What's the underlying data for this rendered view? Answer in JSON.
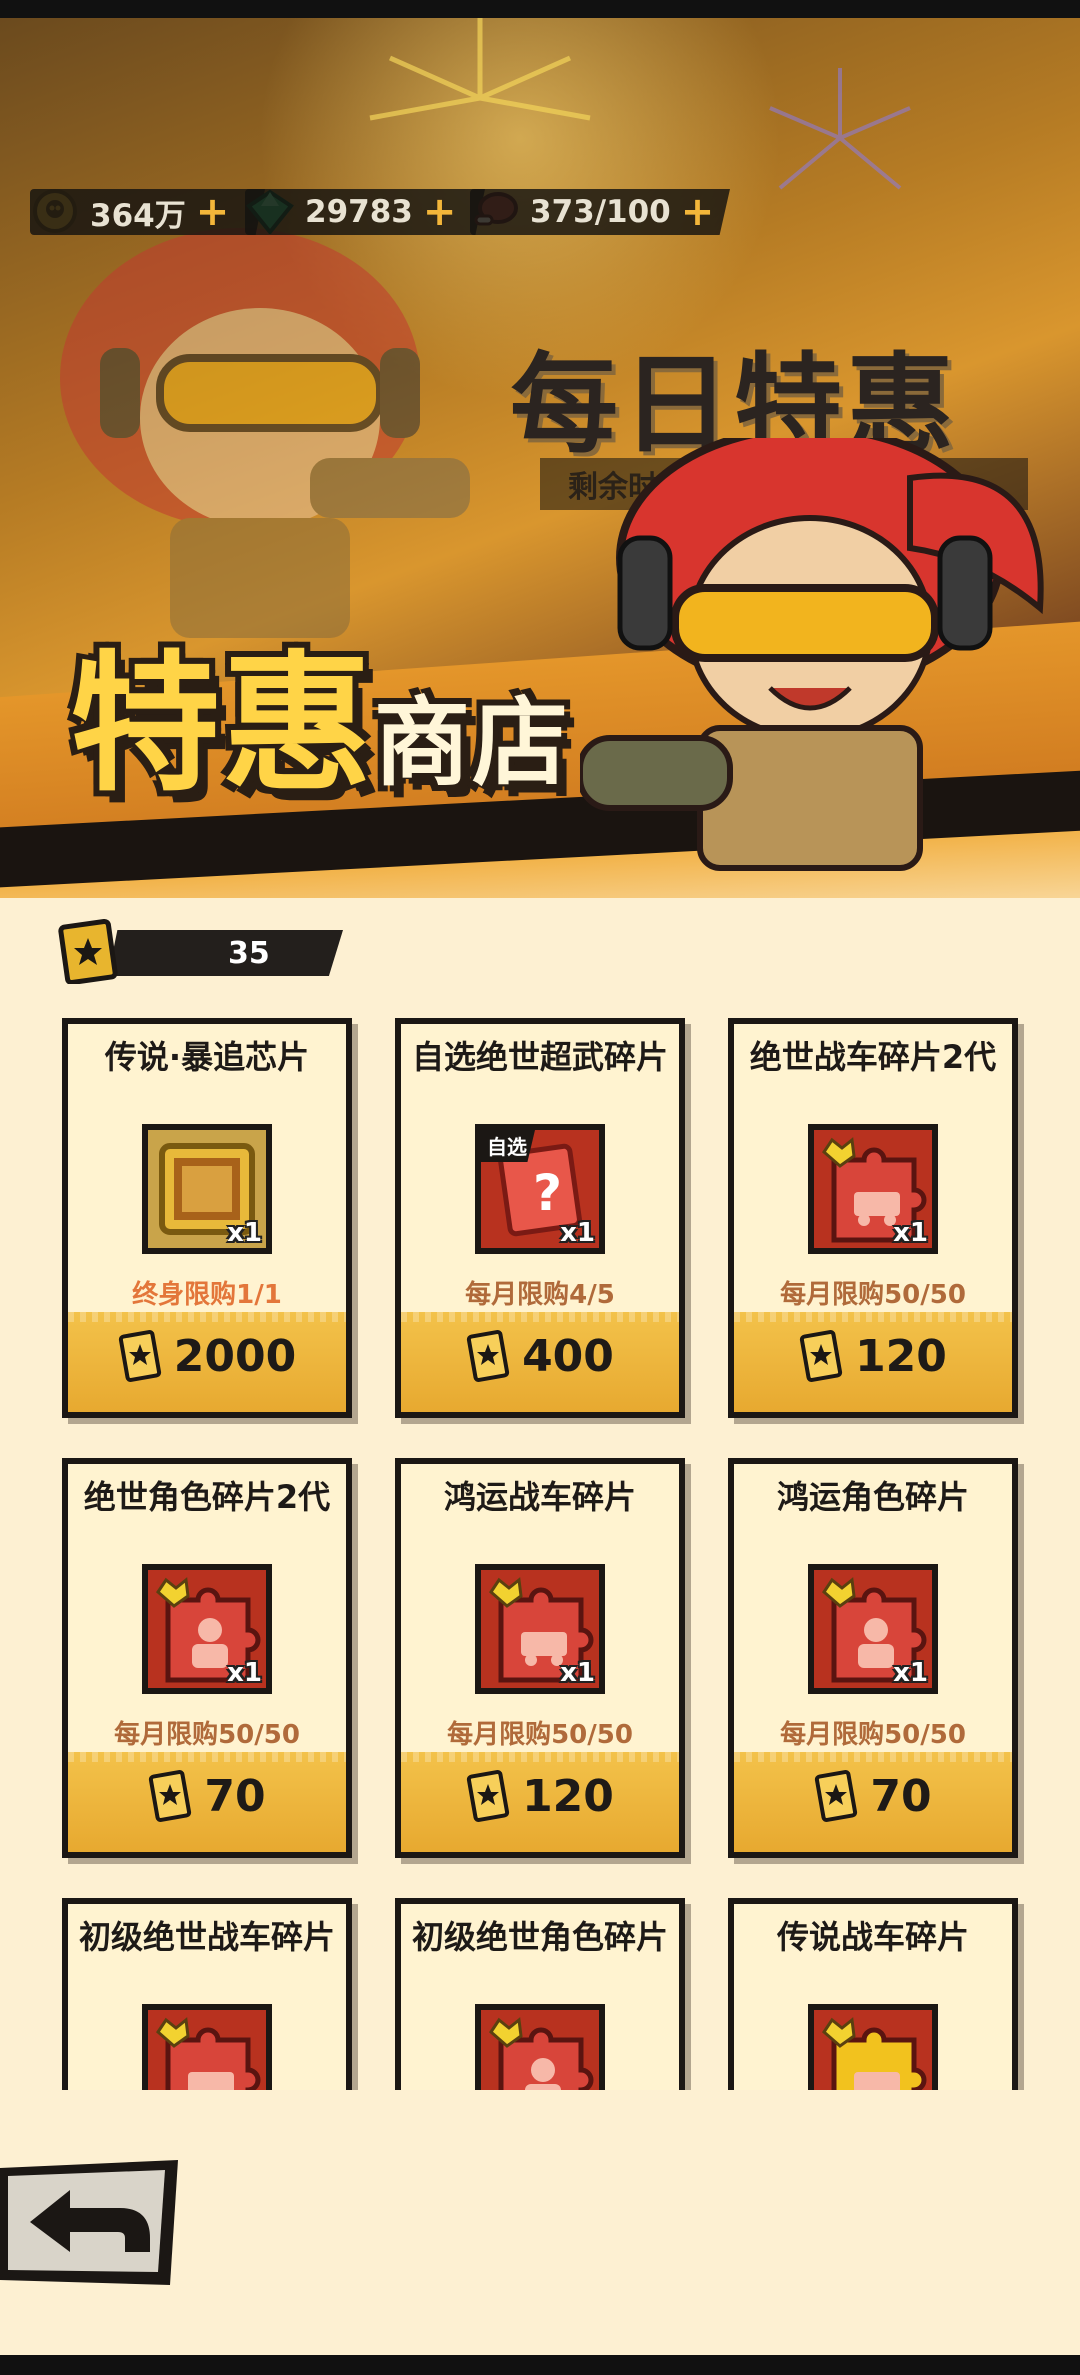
{
  "header": {
    "resources": [
      {
        "icon": "skull-coin-icon",
        "value": "364万"
      },
      {
        "icon": "green-gem-icon",
        "value": "29783"
      },
      {
        "icon": "meat-stamina-icon",
        "value": "373/100"
      }
    ],
    "banner_title": "每日特惠",
    "timer_text": "剩余时间:09时51分59",
    "shop_title_big": "特惠",
    "shop_title_small": "商店"
  },
  "currency": {
    "icon": "star-ticket-icon",
    "value": "35"
  },
  "items": [
    {
      "name": "传说·暴追芯片",
      "icon": "golden-chip-icon",
      "qty": "x1",
      "limit": "终身限购1/1",
      "price": "2000",
      "style": "gold",
      "limit_style": "life"
    },
    {
      "name": "自选绝世超武碎片",
      "icon": "mystery-weapon-shard-icon",
      "qty": "x1",
      "tag": "自选",
      "limit": "每月限购4/5",
      "price": "400",
      "style": "red"
    },
    {
      "name": "绝世战车碎片2代",
      "icon": "vehicle-shard-icon",
      "qty": "x1",
      "limit": "每月限购50/50",
      "price": "120",
      "style": "red"
    },
    {
      "name": "绝世角色碎片2代",
      "icon": "character-shard-icon",
      "qty": "x1",
      "limit": "每月限购50/50",
      "price": "70",
      "style": "red"
    },
    {
      "name": "鸿运战车碎片",
      "icon": "vehicle-shard-icon",
      "qty": "x1",
      "limit": "每月限购50/50",
      "price": "120",
      "style": "red"
    },
    {
      "name": "鸿运角色碎片",
      "icon": "character-shard-icon",
      "qty": "x1",
      "limit": "每月限购50/50",
      "price": "70",
      "style": "red"
    },
    {
      "name": "初级绝世战车碎片",
      "icon": "vehicle-shard-icon",
      "style": "red"
    },
    {
      "name": "初级绝世角色碎片",
      "icon": "character-shard-icon",
      "style": "red"
    },
    {
      "name": "传说战车碎片",
      "icon": "vehicle-shard-icon",
      "style": "gold"
    }
  ],
  "colors": {
    "accent": "#f3c24a",
    "card_bg": "#fff3d0",
    "limit_text": "#b06a3a",
    "lifetime_limit_text": "#e3763a",
    "page_bg": "#fdf0d2"
  }
}
